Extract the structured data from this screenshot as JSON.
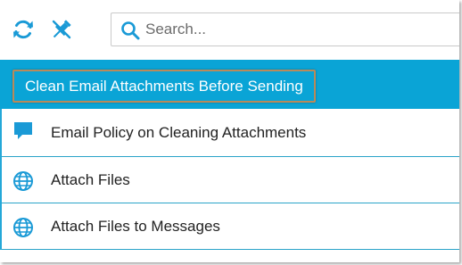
{
  "search": {
    "placeholder": "Search..."
  },
  "toolbar": {
    "refresh_icon": "refresh-icon",
    "unpin_icon": "unpin-icon"
  },
  "results": [
    {
      "label": "Clean Email Attachments Before Sending",
      "icon": "none",
      "selected": true
    },
    {
      "label": "Email Policy on Cleaning Attachments",
      "icon": "speech-bubble-icon",
      "selected": false
    },
    {
      "label": "Attach Files",
      "icon": "globe-icon",
      "selected": false
    },
    {
      "label": "Attach Files to Messages",
      "icon": "globe-icon",
      "selected": false
    }
  ],
  "colors": {
    "accent": "#0aa4d6",
    "icon": "#1a9ad6",
    "selection_outline": "#b98a5a"
  }
}
